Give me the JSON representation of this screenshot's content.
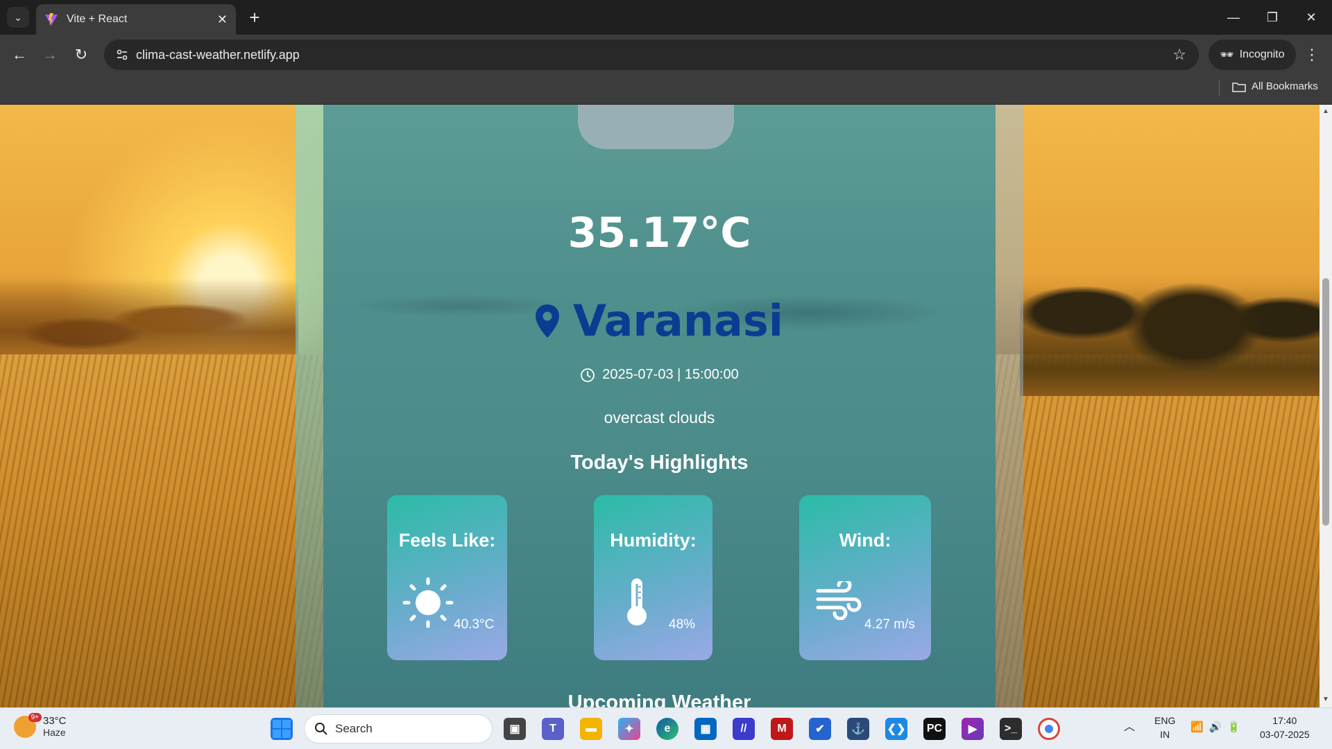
{
  "browser": {
    "tab_title": "Vite + React",
    "url": "clima-cast-weather.netlify.app",
    "incognito_label": "Incognito",
    "bookmarks_label": "All Bookmarks"
  },
  "weather": {
    "temperature": "35.17°C",
    "city": "Varanasi",
    "datetime": "2025-07-03 | 15:00:00",
    "condition": "overcast clouds",
    "highlights_title": "Today's Highlights",
    "highlights": [
      {
        "label": "Feels Like:",
        "value": "40.3°C",
        "icon": "sun-icon"
      },
      {
        "label": "Humidity:",
        "value": "48%",
        "icon": "thermometer-icon"
      },
      {
        "label": "Wind:",
        "value": "4.27 m/s",
        "icon": "wind-icon"
      }
    ],
    "upcoming_title": "Upcoming Weather"
  },
  "taskbar": {
    "weather_temp": "33°C",
    "weather_desc": "Haze",
    "weather_badge": "9+",
    "search_placeholder": "Search",
    "lang_top": "ENG",
    "lang_bottom": "IN",
    "time": "17:40",
    "date": "03-07-2025"
  },
  "colors": {
    "city_text": "#0a3d91",
    "card_gradient_start": "#2bbca6",
    "card_gradient_end": "#9aa9e6"
  }
}
